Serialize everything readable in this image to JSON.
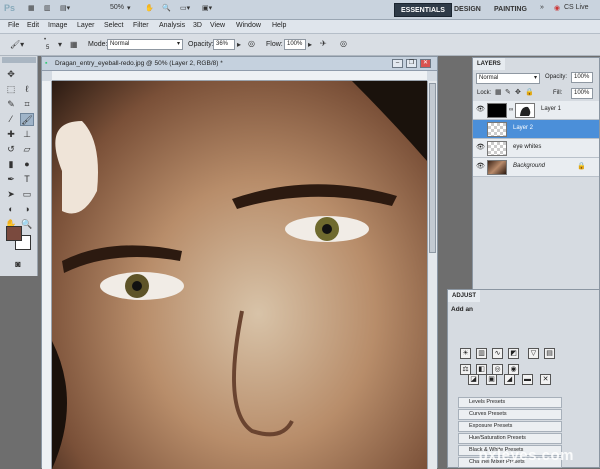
{
  "app": {
    "logo": "Ps",
    "zoom": "50%",
    "workspaces": [
      "ESSENTIALS",
      "DESIGN",
      "PAINTING"
    ],
    "more": "»",
    "cs_live": "CS Live"
  },
  "menu": [
    "File",
    "Edit",
    "Image",
    "Layer",
    "Select",
    "Filter",
    "Analysis",
    "3D",
    "View",
    "Window",
    "Help"
  ],
  "options": {
    "brush_size": "5",
    "mode_label": "Mode:",
    "mode_value": "Normal",
    "opacity_label": "Opacity:",
    "opacity_value": "36%",
    "flow_label": "Flow:",
    "flow_value": "100%"
  },
  "document": {
    "title": "Dragan_entry_eyeball-redo.jpg @ 50% (Layer 2, RGB/8) *"
  },
  "colors": {
    "foreground": "#7a4a3e",
    "background": "#ffffff",
    "selected_layer": "#4b8fd9"
  },
  "layers_panel": {
    "tab": "LAYERS",
    "blend_mode": "Normal",
    "opacity_label": "Opacity:",
    "opacity_value": "100%",
    "lock_label": "Lock:",
    "fill_label": "Fill:",
    "fill_value": "100%",
    "layers": [
      {
        "name": "Layer 1",
        "selected": false
      },
      {
        "name": "Layer 2",
        "selected": true
      },
      {
        "name": "eye whites",
        "selected": false
      },
      {
        "name": "Background",
        "selected": false
      }
    ]
  },
  "adjustments": {
    "tab": "ADJUST",
    "header": "Add an",
    "presets": [
      "Levels Presets",
      "Curves Presets",
      "Exposure Presets",
      "Hue/Saturation Presets",
      "Black & White Presets",
      "Channel Mixer Presets"
    ]
  },
  "watermark": "pxleyes.com"
}
